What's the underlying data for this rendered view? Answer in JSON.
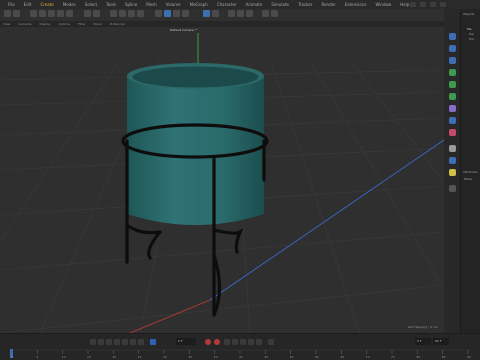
{
  "menu": {
    "items": [
      "File",
      "Edit",
      "Create",
      "Modes",
      "Select",
      "Tools",
      "Spline",
      "Mesh",
      "Volume",
      "MoGraph",
      "Character",
      "Animate",
      "Simulate",
      "Tracker",
      "Render",
      "Extensions",
      "Window",
      "Help"
    ],
    "highlighted_index": 2
  },
  "subbar": {
    "items": [
      "View",
      "Cameras",
      "Display",
      "Options",
      "Filter",
      "Panel",
      "ProRender"
    ]
  },
  "viewport": {
    "camera_label": "Default Camera °°",
    "grid_spacing": "Grid Spacing : 5 cm"
  },
  "object_manager": {
    "title": "Objects",
    "items": [
      "Pla",
      "Pot",
      "Hol"
    ]
  },
  "attributes": {
    "title": "Attributes",
    "mode": "Mode"
  },
  "timeline": {
    "current_frame": "0 F",
    "start_field": "0 F",
    "end_field": "90 F",
    "ticks": [
      "0",
      "5",
      "10",
      "15",
      "20",
      "25",
      "30",
      "35",
      "40",
      "45",
      "50",
      "55",
      "60",
      "65",
      "70",
      "75",
      "80",
      "85",
      "90"
    ]
  },
  "colors": {
    "accent": "#3c6fb0",
    "pot": "#2f7374",
    "stand": "#0d0d0d",
    "axis_x": "#c23b3b",
    "axis_y": "#48b848",
    "axis_z": "#3a6fd8"
  }
}
